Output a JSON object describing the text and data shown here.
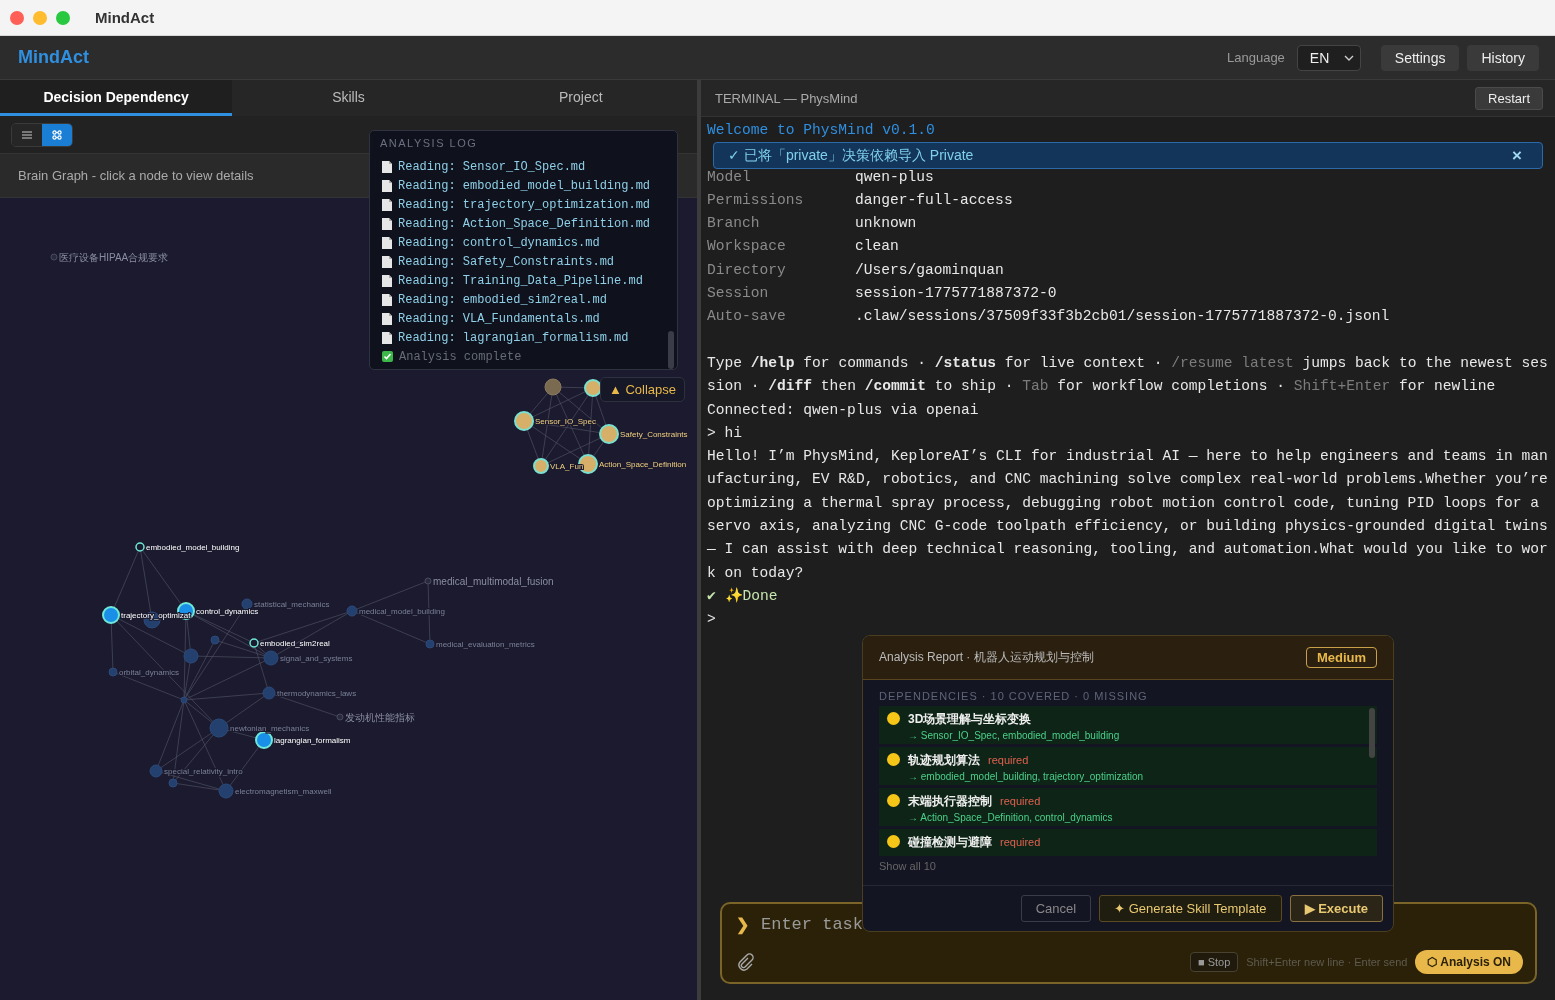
{
  "window": {
    "title": "MindAct"
  },
  "header": {
    "logo": "MindAct",
    "language_label": "Language",
    "language": "EN",
    "buttons": [
      "Settings",
      "History"
    ]
  },
  "left_panel": {
    "tabs": [
      {
        "label": "Decision Dependency",
        "selected": true
      },
      {
        "label": "Skills",
        "selected": false
      },
      {
        "label": "Project",
        "selected": false
      }
    ],
    "view_toggle": [
      {
        "kind": "list",
        "selected": false
      },
      {
        "kind": "graph",
        "selected": true
      }
    ],
    "hint": "Brain Graph - click a node to view details",
    "graph": {
      "nodes": [
        {
          "label": "医疗设备HIPAA合规要求",
          "kind": "dim"
        },
        {
          "kind": "gold_faded"
        },
        {
          "kind": "gold"
        },
        {
          "label": "Sensor_IO_Spec",
          "kind": "gold"
        },
        {
          "label": "Safety_Constraints",
          "kind": "gold"
        },
        {
          "label": "VLA_Fun",
          "kind": "gold"
        },
        {
          "label": "Action_Space_Definition",
          "kind": "gold"
        },
        {
          "label": "embodied_model_building",
          "kind": "ring"
        },
        {
          "label": "trajectory_optimizat",
          "kind": "core"
        },
        {
          "label": "control_dynamics",
          "kind": "core"
        },
        {
          "label": "embodied_sim2real",
          "kind": "ring"
        },
        {
          "label": "lagrangian_formalism",
          "kind": "core"
        },
        {
          "label": "statistical_mechanics",
          "kind": "faded"
        },
        {
          "kind": "faded"
        },
        {
          "kind": "faded"
        },
        {
          "label": "signal_and_systems",
          "kind": "faded"
        },
        {
          "label": "orbital_dynamics",
          "kind": "faded"
        },
        {
          "kind": "faded"
        },
        {
          "label": "thermodynamics_laws",
          "kind": "faded"
        },
        {
          "label": "newtonian_mechanics",
          "kind": "faded"
        },
        {
          "label": "special_relativity_intro",
          "kind": "faded"
        },
        {
          "kind": "faded"
        },
        {
          "label": "electromagnetism_maxwell",
          "kind": "faded"
        },
        {
          "label": "medical_multimodal_fusion",
          "kind": "dim"
        },
        {
          "label": "medical_model_building",
          "kind": "faded"
        },
        {
          "label": "medical_evaluation_metrics",
          "kind": "faded"
        },
        {
          "label": "发动机性能指标",
          "kind": "dim"
        },
        {
          "kind": "faded"
        }
      ]
    },
    "analysis_log": {
      "title": "ANALYSIS LOG",
      "lines": [
        {
          "kind": "file",
          "text": "Reading: Sensor_IO_Spec.md"
        },
        {
          "kind": "file",
          "text": "Reading: embodied_model_building.md"
        },
        {
          "kind": "file",
          "text": "Reading: trajectory_optimization.md"
        },
        {
          "kind": "file",
          "text": "Reading: Action_Space_Definition.md"
        },
        {
          "kind": "file",
          "text": "Reading: control_dynamics.md"
        },
        {
          "kind": "file",
          "text": "Reading: Safety_Constraints.md"
        },
        {
          "kind": "file",
          "text": "Reading: Training_Data_Pipeline.md"
        },
        {
          "kind": "file",
          "text": "Reading: embodied_sim2real.md"
        },
        {
          "kind": "file",
          "text": "Reading: VLA_Fundamentals.md"
        },
        {
          "kind": "file",
          "text": "Reading: lagrangian_formalism.md"
        },
        {
          "kind": "done",
          "text": "Analysis complete"
        }
      ]
    },
    "collapse_button": "▲ Collapse"
  },
  "terminal": {
    "title": "TERMINAL — PhysMind",
    "restart": "Restart",
    "welcome": "Welcome to PhysMind v0.1.0",
    "toast": {
      "text": "✓ 已将「private」决策依赖导入 Private",
      "close": "×"
    },
    "info": [
      {
        "key": "Model",
        "value": "qwen-plus"
      },
      {
        "key": "Permissions",
        "value": "danger-full-access"
      },
      {
        "key": "Branch",
        "value": "unknown"
      },
      {
        "key": "Workspace",
        "value": "clean"
      },
      {
        "key": "Directory",
        "value": "/Users/gaominquan"
      },
      {
        "key": "Session",
        "value": "session-1775771887372-0"
      },
      {
        "key": "Auto-save",
        "value": ".claw/sessions/37509f33f3b2cb01/session-1775771887372-0.jsonl"
      }
    ],
    "help": [
      {
        "kind": "plain",
        "text": "Type "
      },
      {
        "kind": "bold",
        "text": "/help"
      },
      {
        "kind": "plain",
        "text": " for commands · "
      },
      {
        "kind": "bold",
        "text": "/status"
      },
      {
        "kind": "plain",
        "text": " for live context · "
      },
      {
        "kind": "dim",
        "text": "/resume latest"
      },
      {
        "kind": "plain",
        "text": " jumps back to the newest session · "
      },
      {
        "kind": "bold",
        "text": "/diff"
      },
      {
        "kind": "plain",
        "text": " then "
      },
      {
        "kind": "bold",
        "text": "/commit"
      },
      {
        "kind": "plain",
        "text": " to ship · "
      },
      {
        "kind": "dim",
        "text": "Tab"
      },
      {
        "kind": "plain",
        "text": " for workflow completions · "
      },
      {
        "kind": "dim",
        "text": "Shift+Enter"
      },
      {
        "kind": "plain",
        "text": " for newline"
      }
    ],
    "lines": [
      {
        "kind": "plain",
        "text": "Connected: qwen-plus via openai"
      },
      {
        "kind": "plain",
        "text": "> hi"
      },
      {
        "kind": "plain",
        "text": "Hello! I’m PhysMind, KeploreAI’s CLI for industrial AI — here to help engineers and teams in manufacturing, EV R&D, robotics, and CNC machining solve complex real-world problems.Whether you’re optimizing a thermal spray process, debugging robot motion control code, tuning PID loops for a servo axis, analyzing CNC G-code toolpath efficiency, or building physics-grounded digital twins — I can assist with deep technical reasoning, tooling, and automation.What would you like to work on today?"
      },
      {
        "kind": "done",
        "text": "✔ ✨Done"
      },
      {
        "kind": "plain",
        "text": ">"
      }
    ]
  },
  "report": {
    "title": "Analysis Report · 机器人运动规划与控制",
    "level_badge": "Medium",
    "summary": "DEPENDENCIES · 10 COVERED · 0 MISSING",
    "items": [
      {
        "name": "3D场景理解与坐标变换",
        "links": "→ Sensor_IO_Spec, embodied_model_building"
      },
      {
        "name": "轨迹规划算法",
        "required": true,
        "required_label": "required",
        "links": "→ embodied_model_building, trajectory_optimization"
      },
      {
        "name": "末端执行器控制",
        "required": true,
        "required_label": "required",
        "links": "→ Action_Space_Definition, control_dynamics"
      },
      {
        "name": "碰撞检测与避障",
        "required": true,
        "required_label": "required"
      }
    ],
    "show_all": "Show all 10",
    "buttons": [
      {
        "kind": "cancel",
        "label": "Cancel"
      },
      {
        "kind": "secondary",
        "label": "✦ Generate Skill Template"
      },
      {
        "kind": "primary",
        "label": "▶ Execute"
      }
    ]
  },
  "input": {
    "prompt": "❯",
    "placeholder": "Enter task",
    "stop": "■ Stop",
    "hint": "Shift+Enter new line · Enter send",
    "analysis": {
      "label": "⬡ Analysis ON",
      "on": true
    }
  }
}
